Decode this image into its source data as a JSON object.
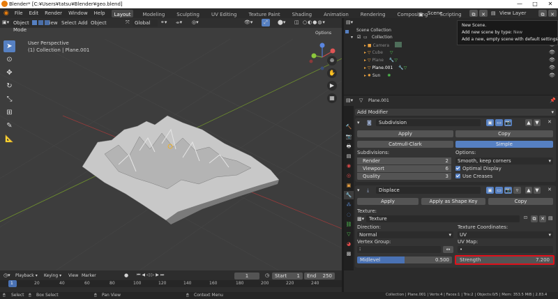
{
  "window": {
    "title": "Blender* [C:¥Users¥tatsu¥Blender¥geo.blend]"
  },
  "menu": [
    "File",
    "Edit",
    "Render",
    "Window",
    "Help"
  ],
  "workspaces": [
    {
      "label": "Layout",
      "active": true
    },
    {
      "label": "Modeling"
    },
    {
      "label": "Sculpting"
    },
    {
      "label": "UV Editing"
    },
    {
      "label": "Texture Paint"
    },
    {
      "label": "Shading"
    },
    {
      "label": "Animation"
    },
    {
      "label": "Rendering"
    },
    {
      "label": "Compositing"
    },
    {
      "label": "Scripting"
    }
  ],
  "scene_label": "Scene",
  "view_layer_label": "View Layer",
  "viewport_header": {
    "mode": "Object Mode",
    "menus": [
      "View",
      "Select",
      "Add",
      "Object"
    ],
    "transform_orientation": "Global",
    "options": "Options"
  },
  "viewport": {
    "perspective": "User Perspective",
    "collection_info": "(1) Collection | Plane.001"
  },
  "outliner": {
    "scene_collection": "Scene Collection",
    "collection": "Collection",
    "items": [
      {
        "name": "Camera",
        "dim": true
      },
      {
        "name": "Cube",
        "dim": true
      },
      {
        "name": "Plane",
        "dim": true
      },
      {
        "name": "Plane.001",
        "dim": false
      },
      {
        "name": "Sun",
        "dim": false
      }
    ]
  },
  "tooltip": {
    "title": "New Scene.",
    "line2_label": "Add new scene by type:",
    "line2_value": "New",
    "line3": "Add a new, empty scene with default settings"
  },
  "properties": {
    "object_name": "Plane.001",
    "add_modifier": "Add Modifier",
    "subdivision": {
      "name": "Subdivision",
      "apply": "Apply",
      "copy": "Copy",
      "tab_catmull": "Catmull-Clark",
      "tab_simple": "Simple",
      "subdivisions_label": "Subdivisions:",
      "render_label": "Render",
      "render_value": "2",
      "viewport_label": "Viewport",
      "viewport_value": "6",
      "quality_label": "Quality",
      "quality_value": "3",
      "options_label": "Options:",
      "uv_smooth": "Smooth, keep corners",
      "optimal_display": "Optimal Display",
      "use_creases": "Use Creases"
    },
    "displace": {
      "name": "Displace",
      "apply": "Apply",
      "apply_shape_key": "Apply as Shape Key",
      "copy": "Copy",
      "texture_label": "Texture:",
      "texture_value": "Texture",
      "direction_label": "Direction:",
      "direction_value": "Normal",
      "tex_coords_label": "Texture Coordinates:",
      "tex_coords_value": "UV",
      "vertex_group_label": "Vertex Group:",
      "uv_map_label": "UV Map:",
      "uv_map_value": "•",
      "midlevel_label": "Midlevel",
      "midlevel_value": "0.500",
      "midlevel_fraction": 0.5,
      "strength_label": "Strength",
      "strength_value": "7.200"
    }
  },
  "timeline": {
    "menus": [
      "Playback",
      "Keying",
      "View",
      "Marker"
    ],
    "current_frame": "1",
    "start_label": "Start",
    "start_value": "1",
    "end_label": "End",
    "end_value": "250",
    "ticks": [
      "1",
      "20",
      "40",
      "60",
      "80",
      "100",
      "120",
      "140",
      "160",
      "180",
      "200",
      "220",
      "240"
    ]
  },
  "statusbar": {
    "select": "Select",
    "box_select": "Box Select",
    "pan_view": "Pan View",
    "context_menu": "Context Menu",
    "stats": "Collection | Plane.001 | Verts:4 | Faces:1 | Tris:2 | Objects:0/5 | Mem: 353.5 MiB | 2.83.4"
  },
  "colors": {
    "accent": "#5680c2",
    "highlight_box": "#e0101a",
    "x_axis": "#9a3b3b",
    "y_axis": "#6e8f2e"
  }
}
